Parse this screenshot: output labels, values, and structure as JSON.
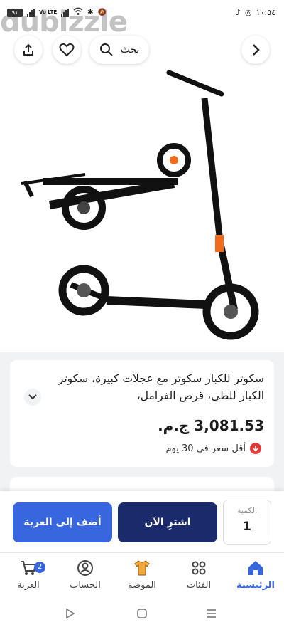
{
  "status_bar": {
    "battery": "٩١",
    "network_label": "Vo LTE",
    "time": "١٠:٥٤"
  },
  "watermark": "dubizzle",
  "header": {
    "search_label": "بحث",
    "icons": [
      "share-icon",
      "heart-icon",
      "search-icon",
      "chevron-right-icon"
    ]
  },
  "product": {
    "title": "سكوتر للكبار سكوتر مع عجلات كبيرة، سكوتر الكبار للطى، قرص الفرامل،",
    "price": "3,081.53 ج.م.",
    "lowest_price_note": "أقل سعر في 30 يوم"
  },
  "actions": {
    "add_to_cart": "أضف إلى العربة",
    "buy_now": "اشترِ الآن",
    "quantity_label": "الكمية",
    "quantity_value": "1"
  },
  "bottom_nav": {
    "items": [
      {
        "label": "العربة",
        "icon": "cart-icon",
        "badge": "2"
      },
      {
        "label": "الحساب",
        "icon": "account-icon"
      },
      {
        "label": "الموضة",
        "icon": "fashion-icon"
      },
      {
        "label": "الفئات",
        "icon": "categories-icon"
      },
      {
        "label": "الرئيسية",
        "icon": "home-icon",
        "active": true
      }
    ]
  },
  "colors": {
    "primary": "#3866df",
    "dark": "#1a2a6b",
    "alert": "#e53935"
  }
}
